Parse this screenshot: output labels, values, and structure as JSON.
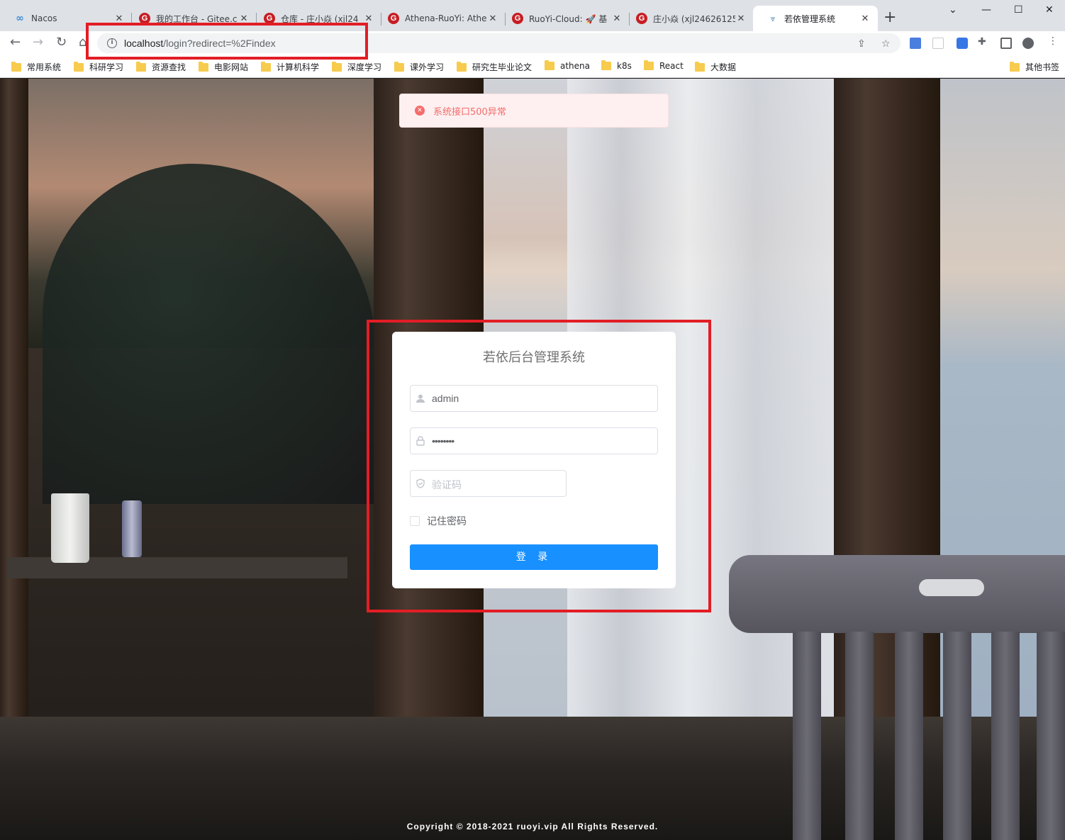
{
  "browser": {
    "tabs": [
      {
        "title": "Nacos",
        "favicon": "nacos-icon"
      },
      {
        "title": "我的工作台 - Gitee.c",
        "favicon": "gitee-icon"
      },
      {
        "title": "仓库 - 庄小焱 (xjl24",
        "favicon": "gitee-icon"
      },
      {
        "title": "Athena-RuoYi: Athe",
        "favicon": "gitee-icon"
      },
      {
        "title": "RuoYi-Cloud: 🚀 基",
        "favicon": "gitee-icon"
      },
      {
        "title": "庄小焱 (xjl24626125",
        "favicon": "gitee-icon"
      },
      {
        "title": "若依管理系统",
        "favicon": "ruoyi-icon"
      }
    ],
    "url": {
      "host": "localhost",
      "path": "/login?redirect=%2Findex"
    },
    "bookmarks": [
      "常用系统",
      "科研学习",
      "资源查找",
      "电影网站",
      "计算机科学",
      "深度学习",
      "课外学习",
      "研究生毕业论文",
      "athena",
      "k8s",
      "React",
      "大数据"
    ],
    "other_bookmarks": "其他书签"
  },
  "alert": {
    "message": "系统接口500异常",
    "color": "#f56c6c"
  },
  "login": {
    "title": "若依后台管理系统",
    "username": "admin",
    "password_mask": "••••••••",
    "captcha_placeholder": "验证码",
    "remember_label": "记住密码",
    "submit_label": "登 录",
    "accent": "#1890ff"
  },
  "footer": "Copyright © 2018-2021 ruoyi.vip All Rights Reserved.",
  "annotation_color": "#e21d25"
}
